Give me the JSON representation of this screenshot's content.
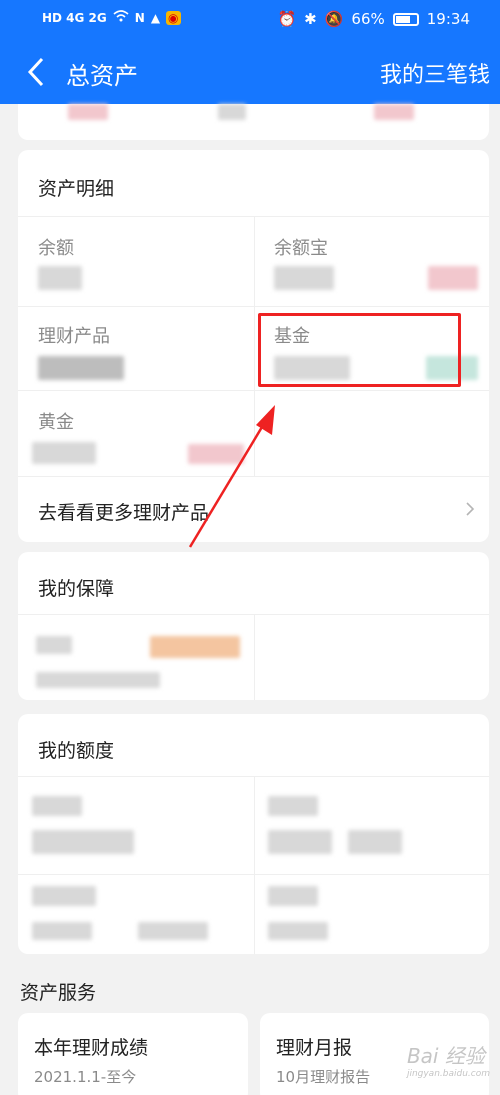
{
  "status_bar": {
    "network": "HD 4G 2G",
    "battery": "66%",
    "time": "19:34"
  },
  "header": {
    "title": "总资产",
    "right_link": "我的三笔钱"
  },
  "asset_detail": {
    "title": "资产明细",
    "items": [
      {
        "label": "余额"
      },
      {
        "label": "余额宝"
      },
      {
        "label": "理财产品"
      },
      {
        "label": "基金"
      },
      {
        "label": "黄金"
      }
    ],
    "more_link": "去看看更多理财产品"
  },
  "protection": {
    "title": "我的保障"
  },
  "credit": {
    "title": "我的额度"
  },
  "services": {
    "title": "资产服务",
    "cards": [
      {
        "title": "本年理财成绩",
        "subtitle": "2021.1.1-至今"
      },
      {
        "title": "理财月报",
        "subtitle": "10月理财报告"
      }
    ]
  },
  "watermark": {
    "text": "Bai 经验",
    "sub": "jingyan.baidu.com"
  },
  "colors": {
    "primary": "#1677ff",
    "highlight": "#ee2222",
    "background": "#f2f2f2"
  }
}
